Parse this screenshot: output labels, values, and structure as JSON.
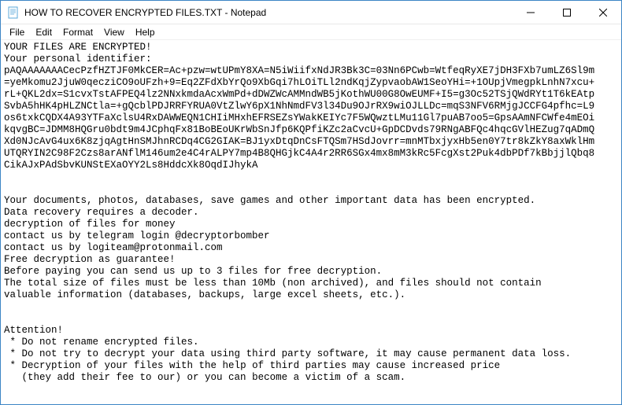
{
  "window": {
    "title": "HOW TO RECOVER ENCRYPTED FILES.TXT - Notepad"
  },
  "menubar": {
    "file": "File",
    "edit": "Edit",
    "format": "Format",
    "view": "View",
    "help": "Help"
  },
  "content": {
    "l1": "YOUR FILES ARE ENCRYPTED!",
    "l2": "Your personal identifier:",
    "l3": "pAQAAAAAAACecPzfHZTJF0MkCER=Ac+pzw=wtUPmY8XA=N5iWiifxNdJR3Bk3C=03Nn6PCwb=WtfeqRyXE7jDH3FXb7umLZ6Sl9m",
    "l4": "=yeMkomu2JjuW0qecziCO9oUFzh+9=Eq2ZFdXbYrQo9XbGqi7hLOiTLl2ndKqjZypvaobAW1SeoYHi=+1OUpjVmegpkLnhN7xcu+",
    "l5": "rL+QKL2dx=S1cvxTstAFPEQ4lz2NNxkmdaAcxWmPd+dDWZWcAMMndWB5jKothWU00G8OwEUMF+I5=g3Oc52TSjQWdRYt1T6kEAtp",
    "l6": "SvbA5hHK4pHLZNCtla=+gQcblPDJRRFYRUA0VtZlwY6pX1NhNmdFV3l34Du9OJrRX9wiOJLLDc=mqS3NFV6RMjgJCCFG4pfhc=L9",
    "l7": "os6txkCQDX4A93YTFaXclsU4RxDAWWEQN1CHIiMHxhEFRSEZsYWakKEIYc7F5WQwztLMu11Gl7puAB7oo5=GpsAAmNFCWfe4mEOi",
    "l8": "kqvgBC=JDMM8HQGru0bdt9m4JCphqFx81BoBEoUKrWbSnJfp6KQPfiKZc2aCvcU+GpDCDvds79RNgABFQc4hqcGVlHEZug7qADmQ",
    "l9": "Xd0NJcAvG4ux6K8zjqAgtHnSMJhnRCDq4CG2GIAK=BJ1yxDtqDnCsFTQSm7HSdJovrr=mnMTbxjyxHb5en0Y7tr8kZkY8axWklHm",
    "l10": "UTQRYIN2C98F2Czs8arANflM146um2e4C4rALPY7mp4B8QHGjkC4A4r2RR6SGx4mx8mM3kRc5FcgXst2Puk4dbPDf7kBbjjlQbq8",
    "l11": "CikAJxPAdSbvKUNStEXaOYY2Ls8HddcXk8OqdIJhykA",
    "l12": "",
    "l13": "",
    "l14": "Your documents, photos, databases, save games and other important data has been encrypted.",
    "l15": "Data recovery requires a decoder.",
    "l16": "decryption of files for money",
    "l17": "contact us by telegram login @decryptorbomber",
    "l18": "contact us by logiteam@protonmail.com",
    "l19": "Free decryption as guarantee!",
    "l20": "Before paying you can send us up to 3 files for free decryption.",
    "l21": "The total size of files must be less than 10Mb (non archived), and files should not contain",
    "l22": "valuable information (databases, backups, large excel sheets, etc.).",
    "l23": "",
    "l24": "",
    "l25": "Attention!",
    "l26": " * Do not rename encrypted files.",
    "l27": " * Do not try to decrypt your data using third party software, it may cause permanent data loss.",
    "l28": " * Decryption of your files with the help of third parties may cause increased price",
    "l29": "   (they add their fee to our) or you can become a victim of a scam."
  }
}
